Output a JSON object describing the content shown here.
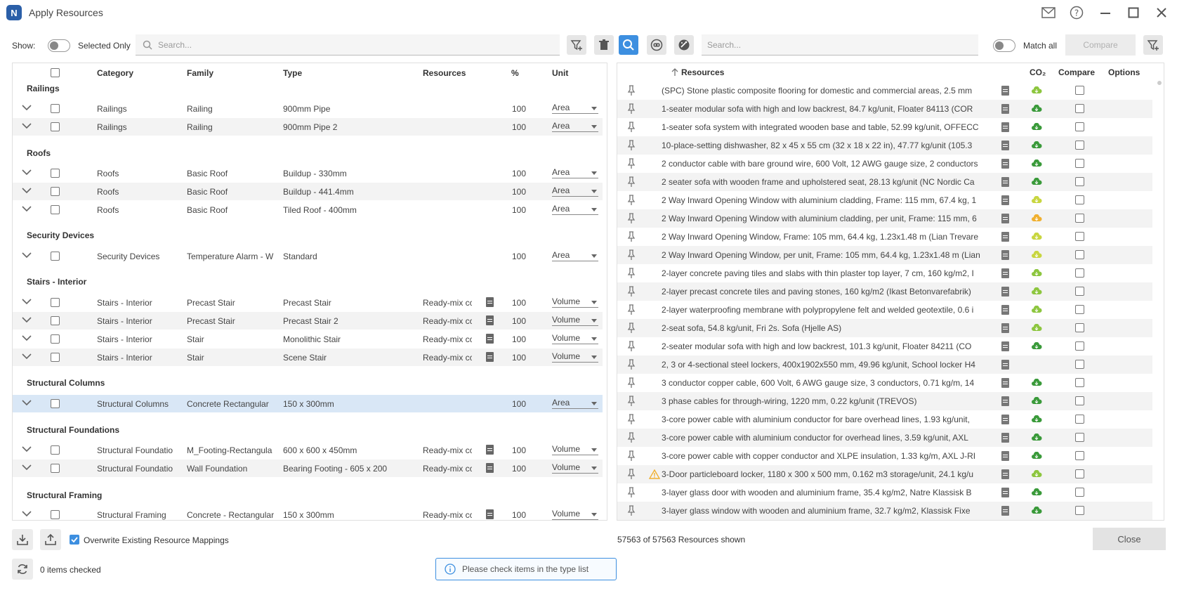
{
  "window": {
    "logo_letter": "N",
    "title": "Apply Resources"
  },
  "toolbar": {
    "show_label": "Show:",
    "selected_only_label": "Selected Only",
    "left_search_placeholder": "Search...",
    "right_search_placeholder": "Search...",
    "match_all_label": "Match all",
    "compare_label": "Compare"
  },
  "left_table": {
    "headers": {
      "category": "Category",
      "family": "Family",
      "type": "Type",
      "resources": "Resources",
      "percent": "%",
      "unit": "Unit"
    },
    "groups": {
      "railings": "Railings",
      "roofs": "Roofs",
      "security": "Security Devices",
      "stairs": "Stairs - Interior",
      "columns": "Structural Columns",
      "foundations": "Structural Foundations",
      "framing": "Structural Framing"
    },
    "rows": [
      {
        "category": "Railings",
        "family": "Railing",
        "type": "900mm Pipe",
        "resources": "",
        "percent": "100",
        "unit": "Area"
      },
      {
        "category": "Railings",
        "family": "Railing",
        "type": "900mm Pipe 2",
        "resources": "",
        "percent": "100",
        "unit": "Area"
      },
      {
        "category": "Roofs",
        "family": "Basic Roof",
        "type": "Buildup - 330mm",
        "resources": "",
        "percent": "100",
        "unit": "Area"
      },
      {
        "category": "Roofs",
        "family": "Basic Roof",
        "type": "Buildup - 441.4mm",
        "resources": "",
        "percent": "100",
        "unit": "Area"
      },
      {
        "category": "Roofs",
        "family": "Basic Roof",
        "type": "Tiled Roof - 400mm",
        "resources": "",
        "percent": "100",
        "unit": "Area"
      },
      {
        "category": "Security Devices",
        "family": "Temperature Alarm - W",
        "type": "Standard",
        "resources": "",
        "percent": "100",
        "unit": "Area"
      },
      {
        "category": "Stairs - Interior",
        "family": "Precast Stair",
        "type": "Precast Stair",
        "resources": "Ready-mix cc",
        "percent": "100",
        "unit": "Volume"
      },
      {
        "category": "Stairs - Interior",
        "family": "Precast Stair",
        "type": "Precast Stair 2",
        "resources": "Ready-mix cc",
        "percent": "100",
        "unit": "Volume"
      },
      {
        "category": "Stairs - Interior",
        "family": "Stair",
        "type": "Monolithic Stair",
        "resources": "Ready-mix cc",
        "percent": "100",
        "unit": "Volume"
      },
      {
        "category": "Stairs - Interior",
        "family": "Stair",
        "type": "Scene Stair",
        "resources": "Ready-mix cc",
        "percent": "100",
        "unit": "Volume"
      },
      {
        "category": "Structural Columns",
        "family": "Concrete Rectangular",
        "type": "150 x 300mm",
        "resources": "",
        "percent": "100",
        "unit": "Area"
      },
      {
        "category": "Structural Foundatio",
        "family": "M_Footing-Rectangula",
        "type": "600 x 600 x 450mm",
        "resources": "Ready-mix cc",
        "percent": "100",
        "unit": "Volume"
      },
      {
        "category": "Structural Foundatio",
        "family": "Wall Foundation",
        "type": "Bearing Footing - 605 x 200",
        "resources": "Ready-mix cc",
        "percent": "100",
        "unit": "Volume"
      },
      {
        "category": "Structural Framing",
        "family": "Concrete - Rectangular",
        "type": "150 x 300mm",
        "resources": "Ready-mix cc",
        "percent": "100",
        "unit": "Volume"
      }
    ]
  },
  "right_table": {
    "headers": {
      "resources": "Resources",
      "co2": "CO₂",
      "compare": "Compare",
      "options": "Options"
    },
    "rows": [
      {
        "name": "(SPC) Stone plastic composite flooring for domestic and commercial areas, 2.5 mm",
        "cloud": "#8dc63f"
      },
      {
        "name": "1-seater modular sofa with high and low backrest, 84.7 kg/unit, Floater 84113 (COR",
        "cloud": "#3a9a3a"
      },
      {
        "name": "1-seater sofa system with integrated wooden base and table, 52.99 kg/unit, OFFECC",
        "cloud": "#3a9a3a"
      },
      {
        "name": "10-place-setting dishwasher, 82 x 45 x 55 cm (32 x 18 x 22 in), 47.77 kg/unit (105.3",
        "cloud": "#3a9a3a"
      },
      {
        "name": "2 conductor cable with bare ground wire, 600 Volt, 12 AWG gauge size, 2 conductors",
        "cloud": "#3a9a3a"
      },
      {
        "name": "2 seater sofa with wooden frame and upholstered seat, 28.13 kg/unit (NC Nordic Ca",
        "cloud": "#3a9a3a"
      },
      {
        "name": "2 Way Inward Opening Window with aluminium cladding, Frame: 115 mm, 67.4 kg, 1",
        "cloud": "#c8d640"
      },
      {
        "name": "2 Way Inward Opening Window with aluminium cladding, per unit, Frame: 115 mm, 6",
        "cloud": "#f0b030"
      },
      {
        "name": "2 Way Inward Opening Window, Frame: 105 mm, 64.4 kg, 1.23x1.48 m (Lian Trevare",
        "cloud": "#c8d640"
      },
      {
        "name": "2 Way Inward Opening Window, per unit, Frame: 105 mm, 64.4 kg, 1.23x1.48 m (Lian",
        "cloud": "#c8d640"
      },
      {
        "name": "2-layer concrete paving tiles and slabs with thin plaster top layer, 7 cm, 160 kg/m2, I",
        "cloud": "#8dc63f"
      },
      {
        "name": "2-layer precast concrete tiles and paving stones, 160 kg/m2 (Ikast Betonvarefabrik)",
        "cloud": "#8dc63f"
      },
      {
        "name": "2-layer waterproofing membrane with polypropylene felt and welded geotextile, 0.6 i",
        "cloud": "#8dc63f"
      },
      {
        "name": "2-seat sofa, 54.8 kg/unit, Fri 2s. Sofa (Hjelle AS)",
        "cloud": "#8dc63f"
      },
      {
        "name": "2-seater modular sofa with high and low backrest, 101.3 kg/unit, Floater 84211 (CO",
        "cloud": "#3a9a3a"
      },
      {
        "name": "2, 3 or 4-sectional steel lockers, 400x1902x550 mm, 49.96 kg/unit, School locker H4",
        "cloud": ""
      },
      {
        "name": "3 conductor copper cable, 600 Volt, 6 AWG gauge size, 3 conductors, 0.71 kg/m, 14",
        "cloud": "#3a9a3a"
      },
      {
        "name": "3 phase cables for through-wiring, 1220 mm, 0.22 kg/unit (TREVOS)",
        "cloud": "#3a9a3a"
      },
      {
        "name": "3-core power cable with aluminium conductor for bare overhead lines, 1.93 kg/unit,",
        "cloud": "#3a9a3a"
      },
      {
        "name": "3-core power cable with aluminium conductor for overhead lines, 3.59 kg/unit, AXL",
        "cloud": "#3a9a3a"
      },
      {
        "name": "3-core power cable with copper conductor and XLPE insulation, 1.33 kg/m, AXL J-RI",
        "cloud": "#3a9a3a"
      },
      {
        "name": "3-Door particleboard locker, 1180 x 300 x 500 mm, 0.162 m3 storage/unit, 24.1 kg/u",
        "cloud": "#8dc63f"
      },
      {
        "name": "3-layer glass door with wooden and aluminium frame, 35.4 kg/m2, Natre Klassisk B",
        "cloud": "#3a9a3a"
      },
      {
        "name": "3-layer glass window with wooden and aluminium frame, 32.7 kg/m2, Klassisk Fixe",
        "cloud": "#3a9a3a"
      }
    ]
  },
  "footer": {
    "overwrite_label": "Overwrite Existing Resource Mappings",
    "items_checked": "0 items checked",
    "resources_shown": "57563 of 57563 Resources shown",
    "close_label": "Close",
    "info_message": "Please check items in the type list"
  },
  "colors": {
    "accent": "#3d8fe0",
    "logo": "#2b5fa8",
    "selected_row": "#d9e7f6",
    "warning": "#f0b030"
  }
}
